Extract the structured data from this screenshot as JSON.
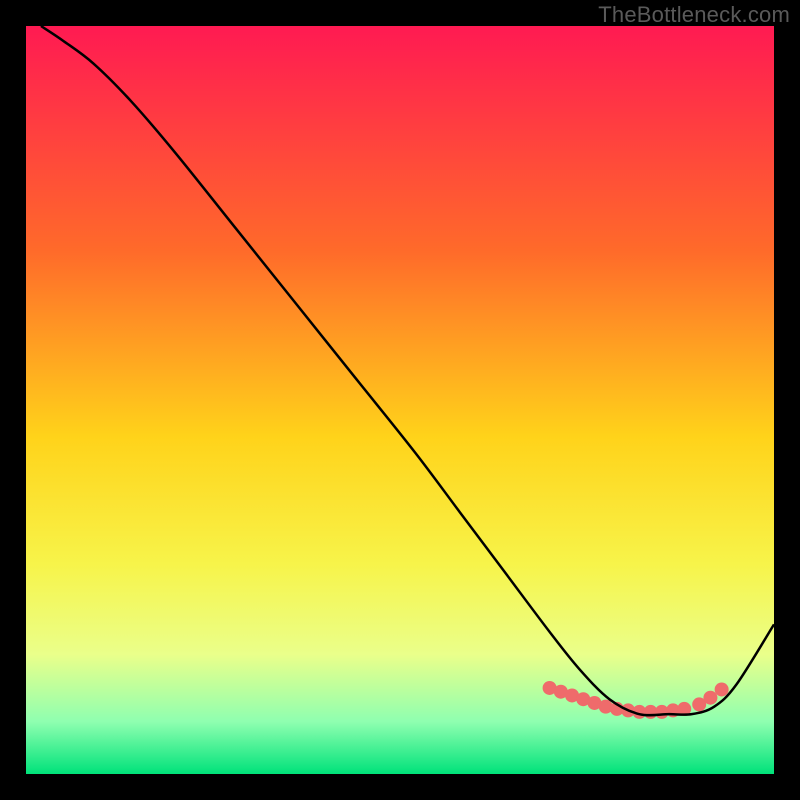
{
  "watermark": "TheBottleneck.com",
  "chart_data": {
    "type": "line",
    "title": "",
    "xlabel": "",
    "ylabel": "",
    "xlim": [
      0,
      100
    ],
    "ylim": [
      0,
      100
    ],
    "grid": false,
    "legend": false,
    "gradient_stops": [
      {
        "offset": 0.0,
        "color": "#ff1a52"
      },
      {
        "offset": 0.3,
        "color": "#ff6a2a"
      },
      {
        "offset": 0.55,
        "color": "#ffd31a"
      },
      {
        "offset": 0.72,
        "color": "#f7f44a"
      },
      {
        "offset": 0.84,
        "color": "#eaff8a"
      },
      {
        "offset": 0.93,
        "color": "#8fffb0"
      },
      {
        "offset": 1.0,
        "color": "#00e27a"
      }
    ],
    "series": [
      {
        "name": "curve",
        "color": "#000000",
        "x": [
          2,
          5,
          9,
          14,
          20,
          28,
          36,
          44,
          52,
          58,
          64,
          70,
          74,
          78,
          82,
          86,
          89,
          92,
          95,
          100
        ],
        "y": [
          100,
          98,
          95,
          90,
          83,
          73,
          63,
          53,
          43,
          35,
          27,
          19,
          14,
          10,
          8,
          8,
          8,
          9,
          12,
          20
        ]
      }
    ],
    "markers": {
      "name": "valley-dots",
      "color": "#ef6b6b",
      "radius_px": 7,
      "points": [
        {
          "x": 70,
          "y": 11.5
        },
        {
          "x": 71.5,
          "y": 11
        },
        {
          "x": 73,
          "y": 10.5
        },
        {
          "x": 74.5,
          "y": 10
        },
        {
          "x": 76,
          "y": 9.5
        },
        {
          "x": 77.5,
          "y": 9
        },
        {
          "x": 79,
          "y": 8.7
        },
        {
          "x": 80.5,
          "y": 8.5
        },
        {
          "x": 82,
          "y": 8.3
        },
        {
          "x": 83.5,
          "y": 8.3
        },
        {
          "x": 85,
          "y": 8.3
        },
        {
          "x": 86.5,
          "y": 8.5
        },
        {
          "x": 88,
          "y": 8.7
        },
        {
          "x": 90,
          "y": 9.3
        },
        {
          "x": 91.5,
          "y": 10.2
        },
        {
          "x": 93,
          "y": 11.3
        }
      ]
    }
  }
}
